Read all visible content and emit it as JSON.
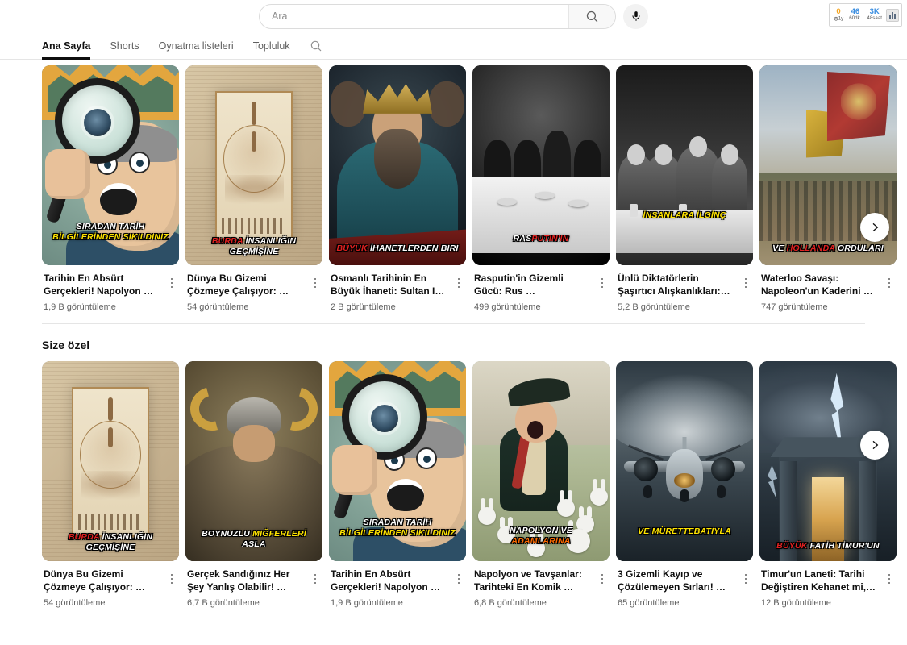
{
  "search": {
    "placeholder": "Ara",
    "value": "",
    "search_icon": "search-icon",
    "mic_icon": "microphone-icon"
  },
  "extension": {
    "stats": [
      {
        "num": "0",
        "sub": "1y",
        "color": "#f5a623"
      },
      {
        "num": "46",
        "sub": "60dk.",
        "color": "#3b8ee0"
      },
      {
        "num": "3K",
        "sub": "48saat",
        "color": "#3b8ee0"
      }
    ],
    "icon": "bar-chart-icon",
    "timer_icon": "timer-icon"
  },
  "tabs": [
    {
      "label": "Ana Sayfa",
      "active": true
    },
    {
      "label": "Shorts",
      "active": false
    },
    {
      "label": "Oynatma listeleri",
      "active": false
    },
    {
      "label": "Topluluk",
      "active": false
    }
  ],
  "tab_search_icon": "search-icon",
  "shelves": [
    {
      "title": "",
      "scroll_next_label": "›",
      "videos": [
        {
          "title": "Tarihin En Absürt\nGerçekleri! Napolyon …",
          "views": "1,9 B görüntüleme",
          "art": "art-cartoon",
          "overlay": [
            {
              "text": "SIRADAN TARİH",
              "color": "#ffffff"
            },
            {
              "text": "BİLGİLERİNDEN SIKILDINIZ",
              "color": "#ffe400"
            }
          ]
        },
        {
          "title": "Dünya Bu Gizemi\nÇözmeye Çalışıyor: …",
          "views": "54 görüntüleme",
          "art": "art-manus",
          "overlay": [
            {
              "text": "BURDA İNSANLIĞIN GEÇMİŞİNE",
              "color": "#ffffff",
              "first_word_color": "#e02020",
              "first_words": 1
            }
          ]
        },
        {
          "title": "Osmanlı Tarihinin En\nBüyük İhaneti: Sultan I…",
          "views": "2 B görüntüleme",
          "art": "art-sultan",
          "overlay": [
            {
              "text": "BÜYÜK İHANETLERDEN BIRI",
              "color": "#ffffff",
              "first_word_color": "#e02020",
              "first_words": 1
            }
          ]
        },
        {
          "title": "Rasputin'in Gizemli\nGücü: Rus …",
          "views": "499 görüntüleme",
          "art": "art-raspu",
          "overlay": [
            {
              "text": "RASPUTIN'IN",
              "color": "#ffffff",
              "first_word_color": "#e02020",
              "split": {
                "white": "RAS",
                "red": "PUTIN'IN"
              }
            }
          ]
        },
        {
          "title": "Ünlü Diktatörlerin\nŞaşırtıcı Alışkanlıkları:…",
          "views": "5,2 B görüntüleme",
          "art": "art-dict",
          "overlay": [
            {
              "text": "İNSANLARA İLGİNÇ",
              "color": "#ffe400"
            }
          ]
        },
        {
          "title": "Waterloo Savaşı:\nNapoleon'un Kaderini …",
          "views": "747 görüntüleme",
          "art": "art-batt",
          "overlay": [
            {
              "text": "VE HOLLANDA ORDULARI",
              "color": "#ffffff",
              "mid_word_color": "#e02020",
              "mid_word_index": 1
            }
          ]
        }
      ]
    },
    {
      "title": "Size özel",
      "scroll_next_label": "›",
      "videos": [
        {
          "title": "Dünya Bu Gizemi\nÇözmeye Çalışıyor: …",
          "views": "54 görüntüleme",
          "art": "art-manus",
          "overlay": [
            {
              "text": "BURDA İNSANLIĞIN GEÇMİŞİNE",
              "color": "#ffffff",
              "first_word_color": "#e02020",
              "first_words": 1
            }
          ]
        },
        {
          "title": "Gerçek Sandığınız Her\nŞey Yanlış Olabilir! …",
          "views": "6,7 B görüntüleme",
          "art": "art-viking",
          "overlay": [
            {
              "text": "BOYNUZLU MIĞFERLERİ",
              "color": "#ffffff",
              "mid_word_color": "#ffe400",
              "mid_word_index": 1
            },
            {
              "text": "ASLA",
              "color": "#ffffff"
            }
          ]
        },
        {
          "title": "Tarihin En Absürt\nGerçekleri! Napolyon …",
          "views": "1,9 B görüntüleme",
          "art": "art-cartoon",
          "overlay": [
            {
              "text": "SIRADAN TARİH",
              "color": "#ffffff"
            },
            {
              "text": "BİLGİLERİNDEN SIKILDINIZ",
              "color": "#ffe400"
            }
          ]
        },
        {
          "title": "Napolyon ve Tavşanlar:\nTarihteki En Komik …",
          "views": "6,8 B görüntüleme",
          "art": "art-napo",
          "overlay": [
            {
              "text": "NAPOLYON VE",
              "color": "#ffffff"
            },
            {
              "text": "ADAMLARINA",
              "color": "#ff6a00"
            }
          ]
        },
        {
          "title": "3 Gizemli Kayıp ve\nÇözülemeyen Sırları! …",
          "views": "65 görüntüleme",
          "art": "art-plane",
          "overlay": [
            {
              "text": "VE MÜRETTEBATIYLA",
              "color": "#ffe400"
            }
          ]
        },
        {
          "title": "Timur'un Laneti: Tarihi\nDeğiştiren Kehanet mi,…",
          "views": "12 B görüntüleme",
          "art": "art-tomb",
          "overlay": [
            {
              "text": "BÜYÜK FATİH TİMUR'UN",
              "color": "#ffffff",
              "first_word_color": "#e02020",
              "first_words": 1
            }
          ]
        }
      ]
    }
  ],
  "colors": {
    "accent_red": "#e02020",
    "accent_yellow": "#ffe400",
    "accent_orange": "#ff6a00",
    "text_primary": "#0f0f0f",
    "text_secondary": "#606060"
  }
}
